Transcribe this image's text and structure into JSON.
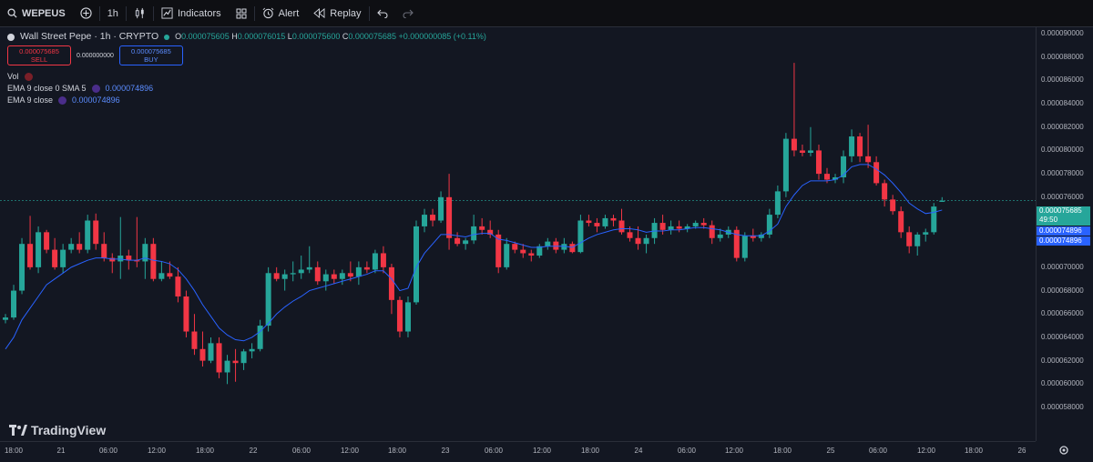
{
  "toolbar": {
    "symbol": "WEPEUS",
    "interval": "1h",
    "indicators_label": "Indicators",
    "alert_label": "Alert",
    "replay_label": "Replay"
  },
  "legend": {
    "title": "Wall Street Pepe · 1h · CRYPTO",
    "o_key": "O",
    "o_val": "0.000075605",
    "h_key": "H",
    "h_val": "0.000076015",
    "l_key": "L",
    "l_val": "0.000075600",
    "c_key": "C",
    "c_val": "0.000075685",
    "change": "+0.000000085 (+0.11%)",
    "sell_price": "0.000075685",
    "sell_label": "SELL",
    "spread": "0.000000000",
    "buy_price": "0.000075685",
    "buy_label": "BUY",
    "vol_label": "Vol",
    "ema_sma_label": "EMA 9 close 0 SMA 5",
    "ema_sma_value": "0.000074896",
    "ema_label": "EMA 9 close",
    "ema_value": "0.000074896"
  },
  "price_tags": {
    "last_price": "0.000075685",
    "countdown": "49:50",
    "ema1": "0.000074896",
    "ema2": "0.000074896"
  },
  "branding": {
    "logo_text": "TradingView"
  },
  "colors": {
    "up": "#26a69a",
    "down": "#f23645",
    "ema": "#2962ff",
    "background": "#131722"
  },
  "chart_data": {
    "type": "candlestick",
    "title": "Wall Street Pepe · 1h · CRYPTO",
    "ylim": [
      5.75e-05,
      9.05e-05
    ],
    "y_ticks": [
      "0.000090000",
      "0.000088000",
      "0.000086000",
      "0.000084000",
      "0.000082000",
      "0.000080000",
      "0.000078000",
      "0.000076000",
      "0.000074000",
      "0.000072000",
      "0.000070000",
      "0.000068000",
      "0.000066000",
      "0.000064000",
      "0.000062000",
      "0.000060000",
      "0.000058000"
    ],
    "x_ticks": [
      "18:00",
      "21",
      "06:00",
      "12:00",
      "18:00",
      "22",
      "06:00",
      "12:00",
      "18:00",
      "23",
      "06:00",
      "12:00",
      "18:00",
      "24",
      "06:00",
      "12:00",
      "18:00",
      "25",
      "06:00",
      "12:00",
      "18:00",
      "26"
    ],
    "grid": false,
    "series": [
      {
        "type": "ohlc",
        "values": [
          [
            6.55e-05,
            6.6e-05,
            6.52e-05,
            6.57e-05
          ],
          [
            6.57e-05,
            6.85e-05,
            6.55e-05,
            6.8e-05
          ],
          [
            6.8e-05,
            7.25e-05,
            6.77e-05,
            7.2e-05
          ],
          [
            7.2e-05,
            7.44e-05,
            6.98e-05,
            7e-05
          ],
          [
            7e-05,
            7.35e-05,
            6.95e-05,
            7.3e-05
          ],
          [
            7.3e-05,
            7.32e-05,
            7.12e-05,
            7.15e-05
          ],
          [
            7.15e-05,
            7.25e-05,
            6.98e-05,
            7e-05
          ],
          [
            7e-05,
            7.2e-05,
            6.95e-05,
            7.15e-05
          ],
          [
            7.15e-05,
            7.25e-05,
            7.12e-05,
            7.2e-05
          ],
          [
            7.2e-05,
            7.3e-05,
            7.12e-05,
            7.15e-05
          ],
          [
            7.15e-05,
            7.45e-05,
            7.12e-05,
            7.4e-05
          ],
          [
            7.4e-05,
            7.46e-05,
            7.15e-05,
            7.2e-05
          ],
          [
            7.2e-05,
            7.3e-05,
            7.05e-05,
            7.08e-05
          ],
          [
            7.08e-05,
            7.12e-05,
            6.95e-05,
            7.05e-05
          ],
          [
            7.05e-05,
            7.43e-05,
            6.9e-05,
            7.1e-05
          ],
          [
            7.1e-05,
            7.15e-05,
            6.98e-05,
            7.06e-05
          ],
          [
            7.06e-05,
            7.43e-05,
            7e-05,
            7.05e-05
          ],
          [
            7.05e-05,
            7.25e-05,
            6.9e-05,
            7.2e-05
          ],
          [
            7.2e-05,
            7.25e-05,
            6.88e-05,
            6.9e-05
          ],
          [
            6.9e-05,
            7.05e-05,
            6.88e-05,
            6.95e-05
          ],
          [
            6.95e-05,
            7.05e-05,
            6.9e-05,
            6.92e-05
          ],
          [
            6.92e-05,
            7e-05,
            6.7e-05,
            6.75e-05
          ],
          [
            6.75e-05,
            6.8e-05,
            6.4e-05,
            6.45e-05
          ],
          [
            6.45e-05,
            6.6e-05,
            6.25e-05,
            6.3e-05
          ],
          [
            6.3e-05,
            6.45e-05,
            6.15e-05,
            6.2e-05
          ],
          [
            6.2e-05,
            6.4e-05,
            6.18e-05,
            6.35e-05
          ],
          [
            6.35e-05,
            6.4e-05,
            6.05e-05,
            6.1e-05
          ],
          [
            6.1e-05,
            6.25e-05,
            6e-05,
            6.2e-05
          ],
          [
            6.2e-05,
            6.3e-05,
            6.02e-05,
            6.18e-05
          ],
          [
            6.18e-05,
            6.3e-05,
            6.12e-05,
            6.28e-05
          ],
          [
            6.28e-05,
            6.35e-05,
            6.22e-05,
            6.3e-05
          ],
          [
            6.3e-05,
            6.55e-05,
            6.28e-05,
            6.5e-05
          ],
          [
            6.5e-05,
            7e-05,
            6.45e-05,
            6.95e-05
          ],
          [
            6.95e-05,
            7e-05,
            6.88e-05,
            6.9e-05
          ],
          [
            6.9e-05,
            6.98e-05,
            6.8e-05,
            6.94e-05
          ],
          [
            6.94e-05,
            7.05e-05,
            6.88e-05,
            6.95e-05
          ],
          [
            6.95e-05,
            7.1e-05,
            6.9e-05,
            6.98e-05
          ],
          [
            6.98e-05,
            7.18e-05,
            6.95e-05,
            7e-05
          ],
          [
            7e-05,
            7.05e-05,
            6.85e-05,
            6.88e-05
          ],
          [
            6.88e-05,
            6.98e-05,
            6.8e-05,
            6.94e-05
          ],
          [
            6.94e-05,
            6.98e-05,
            6.86e-05,
            6.9e-05
          ],
          [
            6.9e-05,
            6.98e-05,
            6.85e-05,
            6.95e-05
          ],
          [
            6.95e-05,
            7.05e-05,
            6.88e-05,
            6.92e-05
          ],
          [
            6.92e-05,
            7.05e-05,
            6.85e-05,
            7e-05
          ],
          [
            7e-05,
            7.05e-05,
            6.95e-05,
            6.98e-05
          ],
          [
            6.98e-05,
            7.15e-05,
            6.95e-05,
            7.12e-05
          ],
          [
            7.12e-05,
            7.18e-05,
            6.95e-05,
            7e-05
          ],
          [
            7e-05,
            7.03e-05,
            6.6e-05,
            6.72e-05
          ],
          [
            6.72e-05,
            6.75e-05,
            6.4e-05,
            6.45e-05
          ],
          [
            6.45e-05,
            6.75e-05,
            6.4e-05,
            6.7e-05
          ],
          [
            6.7e-05,
            7.4e-05,
            6.68e-05,
            7.35e-05
          ],
          [
            7.35e-05,
            7.5e-05,
            7.3e-05,
            7.45e-05
          ],
          [
            7.45e-05,
            7.5e-05,
            7.35e-05,
            7.4e-05
          ],
          [
            7.4e-05,
            7.65e-05,
            7.38e-05,
            7.6e-05
          ],
          [
            7.6e-05,
            7.8e-05,
            7.15e-05,
            7.25e-05
          ],
          [
            7.25e-05,
            7.3e-05,
            7.18e-05,
            7.2e-05
          ],
          [
            7.2e-05,
            7.25e-05,
            7.15e-05,
            7.23e-05
          ],
          [
            7.23e-05,
            7.45e-05,
            7.2e-05,
            7.35e-05
          ],
          [
            7.35e-05,
            7.42e-05,
            7.28e-05,
            7.32e-05
          ],
          [
            7.32e-05,
            7.4e-05,
            7.25e-05,
            7.28e-05
          ],
          [
            7.28e-05,
            7.32e-05,
            6.95e-05,
            7e-05
          ],
          [
            7e-05,
            7.25e-05,
            6.98e-05,
            7.2e-05
          ],
          [
            7.2e-05,
            7.22e-05,
            7.12e-05,
            7.15e-05
          ],
          [
            7.15e-05,
            7.2e-05,
            7.08e-05,
            7.12e-05
          ],
          [
            7.12e-05,
            7.15e-05,
            7.05e-05,
            7.1e-05
          ],
          [
            7.1e-05,
            7.2e-05,
            7.08e-05,
            7.18e-05
          ],
          [
            7.18e-05,
            7.25e-05,
            7.15e-05,
            7.22e-05
          ],
          [
            7.22e-05,
            7.25e-05,
            7.12e-05,
            7.15e-05
          ],
          [
            7.15e-05,
            7.25e-05,
            7.12e-05,
            7.2e-05
          ],
          [
            7.2e-05,
            7.22e-05,
            7.12e-05,
            7.13e-05
          ],
          [
            7.13e-05,
            7.45e-05,
            7.12e-05,
            7.4e-05
          ],
          [
            7.4e-05,
            7.45e-05,
            7.35e-05,
            7.38e-05
          ],
          [
            7.38e-05,
            7.42e-05,
            7.3e-05,
            7.35e-05
          ],
          [
            7.35e-05,
            7.45e-05,
            7.33e-05,
            7.42e-05
          ],
          [
            7.42e-05,
            7.45e-05,
            7.35e-05,
            7.4e-05
          ],
          [
            7.4e-05,
            7.5e-05,
            7.28e-05,
            7.3e-05
          ],
          [
            7.3e-05,
            7.35e-05,
            7.22e-05,
            7.25e-05
          ],
          [
            7.25e-05,
            7.35e-05,
            7.15e-05,
            7.2e-05
          ],
          [
            7.2e-05,
            7.28e-05,
            7.12e-05,
            7.25e-05
          ],
          [
            7.25e-05,
            7.42e-05,
            7.2e-05,
            7.38e-05
          ],
          [
            7.38e-05,
            7.45e-05,
            7.28e-05,
            7.32e-05
          ],
          [
            7.32e-05,
            7.4e-05,
            7.28e-05,
            7.35e-05
          ],
          [
            7.35e-05,
            7.4e-05,
            7.3e-05,
            7.33e-05
          ],
          [
            7.33e-05,
            7.37e-05,
            7.3e-05,
            7.35e-05
          ],
          [
            7.35e-05,
            7.4e-05,
            7.33e-05,
            7.38e-05
          ],
          [
            7.38e-05,
            7.42e-05,
            7.33e-05,
            7.36e-05
          ],
          [
            7.36e-05,
            7.4e-05,
            7.2e-05,
            7.25e-05
          ],
          [
            7.25e-05,
            7.33e-05,
            7.22e-05,
            7.28e-05
          ],
          [
            7.28e-05,
            7.35e-05,
            7.25e-05,
            7.32e-05
          ],
          [
            7.32e-05,
            7.35e-05,
            7.05e-05,
            7.08e-05
          ],
          [
            7.08e-05,
            7.3e-05,
            7.05e-05,
            7.27e-05
          ],
          [
            7.27e-05,
            7.33e-05,
            7.22e-05,
            7.25e-05
          ],
          [
            7.25e-05,
            7.3e-05,
            7.22e-05,
            7.28e-05
          ],
          [
            7.28e-05,
            7.5e-05,
            7.25e-05,
            7.45e-05
          ],
          [
            7.45e-05,
            7.7e-05,
            7.42e-05,
            7.65e-05
          ],
          [
            7.65e-05,
            8.15e-05,
            7.6e-05,
            8.1e-05
          ],
          [
            8.1e-05,
            8.75e-05,
            7.95e-05,
            8e-05
          ],
          [
            8e-05,
            8.05e-05,
            7.95e-05,
            7.98e-05
          ],
          [
            7.98e-05,
            8.2e-05,
            7.95e-05,
            8e-05
          ],
          [
            8e-05,
            8.05e-05,
            7.75e-05,
            7.8e-05
          ],
          [
            7.8e-05,
            7.85e-05,
            7.72e-05,
            7.75e-05
          ],
          [
            7.75e-05,
            7.8e-05,
            7.72e-05,
            7.77e-05
          ],
          [
            7.77e-05,
            8e-05,
            7.72e-05,
            7.95e-05
          ],
          [
            7.95e-05,
            8.18e-05,
            7.9e-05,
            8.12e-05
          ],
          [
            8.12e-05,
            8.15e-05,
            7.9e-05,
            7.95e-05
          ],
          [
            7.95e-05,
            8.22e-05,
            7.85e-05,
            7.9e-05
          ],
          [
            7.9e-05,
            7.95e-05,
            7.7e-05,
            7.72e-05
          ],
          [
            7.72e-05,
            7.75e-05,
            7.52e-05,
            7.58e-05
          ],
          [
            7.58e-05,
            7.62e-05,
            7.45e-05,
            7.48e-05
          ],
          [
            7.48e-05,
            7.52e-05,
            7.25e-05,
            7.3e-05
          ],
          [
            7.3e-05,
            7.35e-05,
            7.12e-05,
            7.18e-05
          ],
          [
            7.18e-05,
            7.3e-05,
            7.1e-05,
            7.28e-05
          ],
          [
            7.28e-05,
            7.33e-05,
            7.22e-05,
            7.3e-05
          ],
          [
            7.3e-05,
            7.55e-05,
            7.28e-05,
            7.52e-05
          ],
          [
            7.56e-05,
            7.6e-05,
            7.56e-05,
            7.57e-05
          ]
        ]
      },
      {
        "type": "line",
        "values": [
          6.3e-05,
          6.4e-05,
          6.55e-05,
          6.65e-05,
          6.75e-05,
          6.85e-05,
          6.9e-05,
          6.95e-05,
          7e-05,
          7.03e-05,
          7.06e-05,
          7.08e-05,
          7.08e-05,
          7.07e-05,
          7.07e-05,
          7.06e-05,
          7.06e-05,
          7.08e-05,
          7.06e-05,
          7.05e-05,
          7.03e-05,
          6.98e-05,
          6.9e-05,
          6.8e-05,
          6.68e-05,
          6.58e-05,
          6.48e-05,
          6.42e-05,
          6.38e-05,
          6.37e-05,
          6.4e-05,
          6.45e-05,
          6.52e-05,
          6.6e-05,
          6.66e-05,
          6.71e-05,
          6.75e-05,
          6.8e-05,
          6.82e-05,
          6.84e-05,
          6.86e-05,
          6.88e-05,
          6.9e-05,
          6.92e-05,
          6.94e-05,
          6.97e-05,
          6.97e-05,
          6.9e-05,
          6.8e-05,
          6.82e-05,
          7e-05,
          7.12e-05,
          7.2e-05,
          7.28e-05,
          7.28e-05,
          7.27e-05,
          7.26e-05,
          7.28e-05,
          7.29e-05,
          7.29e-05,
          7.24e-05,
          7.23e-05,
          7.21e-05,
          7.19e-05,
          7.17e-05,
          7.17e-05,
          7.18e-05,
          7.18e-05,
          7.18e-05,
          7.17e-05,
          7.21e-05,
          7.25e-05,
          7.28e-05,
          7.3e-05,
          7.32e-05,
          7.33e-05,
          7.33e-05,
          7.32e-05,
          7.3e-05,
          7.31e-05,
          7.31e-05,
          7.32e-05,
          7.32e-05,
          7.33e-05,
          7.34e-05,
          7.34e-05,
          7.33e-05,
          7.32e-05,
          7.3e-05,
          7.28e-05,
          7.27e-05,
          7.27e-05,
          7.27e-05,
          7.31e-05,
          7.37e-05,
          7.52e-05,
          7.62e-05,
          7.7e-05,
          7.74e-05,
          7.74e-05,
          7.74e-05,
          7.75e-05,
          7.79e-05,
          7.86e-05,
          7.88e-05,
          7.88e-05,
          7.84e-05,
          7.79e-05,
          7.72e-05,
          7.64e-05,
          7.55e-05,
          7.5e-05,
          7.46e-05,
          7.47e-05,
          7.49e-05
        ]
      }
    ]
  }
}
